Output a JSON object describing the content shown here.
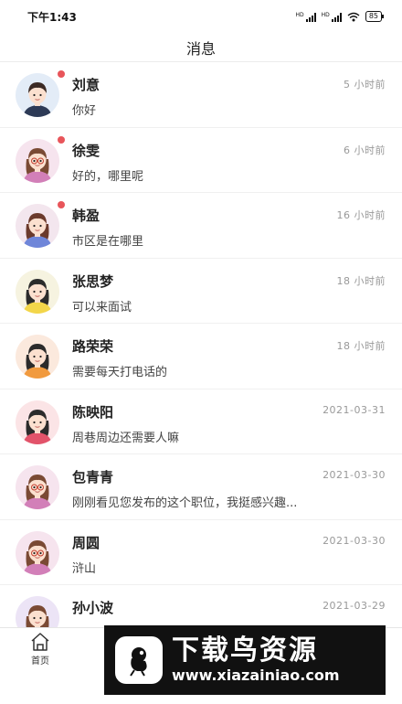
{
  "status_bar": {
    "time": "下午1:43",
    "battery": "85",
    "signal_label": "HD"
  },
  "header": {
    "title": "消息"
  },
  "conversations": [
    {
      "name": "刘意",
      "time": "5 小时前",
      "message": "你好",
      "unread": true,
      "avatar": "avatar-man"
    },
    {
      "name": "徐雯",
      "time": "6 小时前",
      "message": "好的，哪里呢",
      "unread": true,
      "avatar": "avatar-woman-glasses"
    },
    {
      "name": "韩盈",
      "time": "16 小时前",
      "message": "市区是在哪里",
      "unread": true,
      "avatar": "avatar-woman"
    },
    {
      "name": "张思梦",
      "time": "18 小时前",
      "message": "可以来面试",
      "unread": false,
      "avatar": "avatar-woman-yellow"
    },
    {
      "name": "路荣荣",
      "time": "18 小时前",
      "message": "需要每天打电话的",
      "unread": false,
      "avatar": "avatar-woman-orange"
    },
    {
      "name": "陈映阳",
      "time": "2021-03-31",
      "message": "周巷周边还需要人嘛",
      "unread": false,
      "avatar": "avatar-woman-red"
    },
    {
      "name": "包青青",
      "time": "2021-03-30",
      "message": "刚刚看见您发布的这个职位，我挺感兴趣...",
      "unread": false,
      "avatar": "avatar-woman-glasses"
    },
    {
      "name": "周圆",
      "time": "2021-03-30",
      "message": "浒山",
      "unread": false,
      "avatar": "avatar-woman-glasses"
    },
    {
      "name": "孙小波",
      "time": "2021-03-29",
      "message": "",
      "unread": false,
      "avatar": "avatar-woman-purple"
    }
  ],
  "tab_bar": {
    "home_label": "首页"
  },
  "watermark": {
    "title": "下载鸟资源",
    "url": "www.xiazainiao.com"
  },
  "colors": {
    "unread_dot": "#e8555a",
    "time_text": "#999999"
  }
}
